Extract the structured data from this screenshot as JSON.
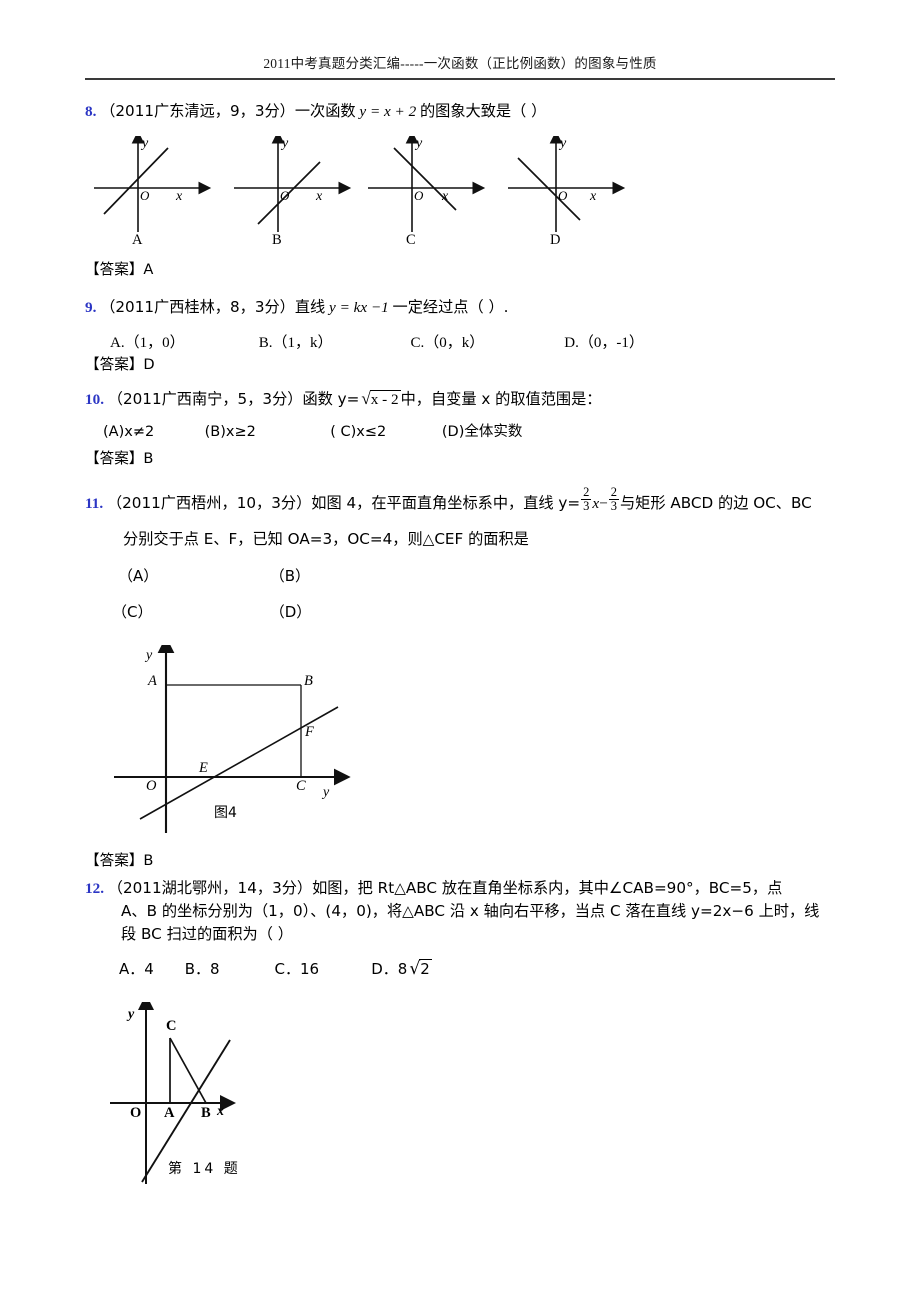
{
  "header": {
    "title": "2011中考真题分类汇编-----一次函数（正比例函数）的图象与性质"
  },
  "questions": [
    {
      "number": "8.",
      "stem_pre": "（2011广东清远，9，3分）一次函数",
      "formula": "y = x + 2",
      "stem_post": "的图象大致是（        ）",
      "answer": "【答案】A",
      "graph_options": [
        {
          "label": "A",
          "slope": "positive",
          "intercept": "positive"
        },
        {
          "label": "B",
          "slope": "positive",
          "intercept": "negative"
        },
        {
          "label": "C",
          "slope": "negative",
          "intercept": "positive"
        },
        {
          "label": "D",
          "slope": "negative",
          "intercept": "negative"
        }
      ],
      "axis_x": "x",
      "axis_y": "y",
      "origin": "O"
    },
    {
      "number": "9.",
      "stem_pre": "（2011广西桂林，8，3分）直线",
      "formula": "y = kx −1",
      "stem_post": "一定经过点（      ）.",
      "options": [
        "A.（1，0）",
        "B.（1，k）",
        "C.（0，k）",
        "D.（0，-1）"
      ],
      "answer": "【答案】D"
    },
    {
      "number": "10.",
      "stem_pre": "（2011广西南宁，5，3分）函数 y=",
      "radicand": "x - 2",
      "stem_post": "中，自变量 x 的取值范围是：",
      "options": [
        "(A)x≠2",
        "(B)x≥2",
        "( C)x≤2",
        "(D)全体实数"
      ],
      "answer": "【答案】B"
    },
    {
      "number": "11.",
      "line1_pre": "（2011广西梧州，10，3分）如图 4，在平面直角坐标系中，直线 y=",
      "frac1_num": "2",
      "frac1_den": "3",
      "mid": "x",
      "minus": "−",
      "frac2_num": "2",
      "frac2_den": "3",
      "line1_post": "与矩形 ABCD 的边 OC、BC",
      "line2": "分别交于点 E、F，已知 OA=3，OC=4，则△CEF 的面积是",
      "options": [
        "（A）",
        "（B）",
        "（C）",
        "（D）"
      ],
      "answer": "【答案】B",
      "figure": {
        "caption": "图4",
        "labels": {
          "y_axis": "y",
          "x_axis": "y",
          "origin": "O",
          "A": "A",
          "B": "B",
          "C": "C",
          "E": "E",
          "F": "F"
        }
      }
    },
    {
      "number": "12.",
      "line1": "（2011湖北鄂州，14，3分）如图，把 Rt△ABC 放在直角坐标系内，其中∠CAB=90°，BC=5，点",
      "line2": "A、B 的坐标分别为（1，0）、(4，0)，将△ABC 沿 x 轴向右平移，当点 C 落在直线 y=2x−6 上时，线",
      "line3": "段 BC 扫过的面积为（      ）",
      "options_a": "A．4",
      "options_b": "B．8",
      "options_c": "C．16",
      "options_d_pre": "D．8",
      "options_d_radicand": "2",
      "figure": {
        "caption": "第 14 题",
        "labels": {
          "y_axis": "y",
          "x_axis": "x",
          "origin": "O",
          "A": "A",
          "B": "B",
          "C": "C"
        }
      }
    }
  ]
}
